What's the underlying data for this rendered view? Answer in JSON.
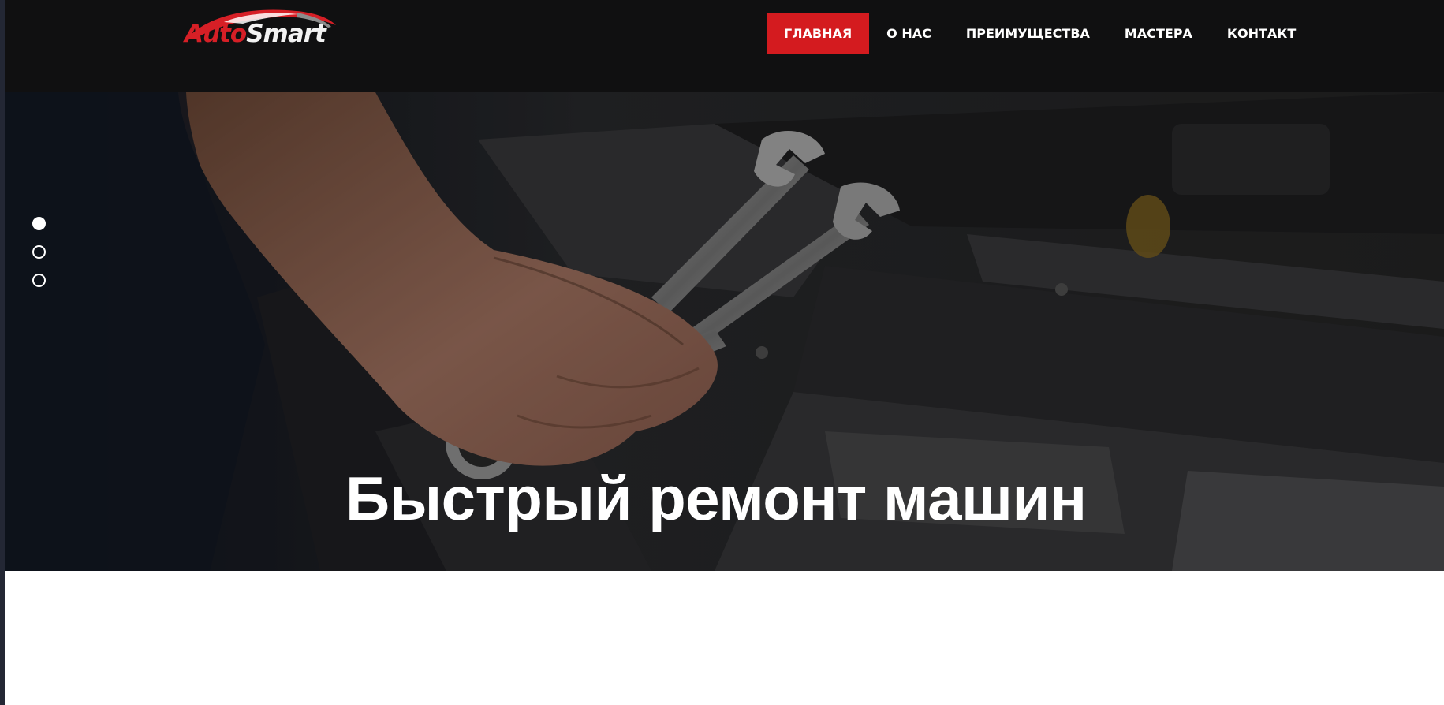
{
  "header": {
    "logo": {
      "part1": "Auto",
      "part2": "Smart"
    },
    "nav": [
      {
        "label": "ГЛАВНАЯ",
        "active": true
      },
      {
        "label": "О НАС",
        "active": false
      },
      {
        "label": "ПРЕИМУЩЕСТВА",
        "active": false
      },
      {
        "label": "МАСТЕРА",
        "active": false
      },
      {
        "label": "КОНТАКТ",
        "active": false
      }
    ]
  },
  "hero": {
    "title": "Быстрый ремонт машин",
    "slides": {
      "count": 3,
      "active_index": 0
    }
  },
  "colors": {
    "header_bg": "#101011",
    "accent": "#d41b1f",
    "text": "#ffffff"
  }
}
